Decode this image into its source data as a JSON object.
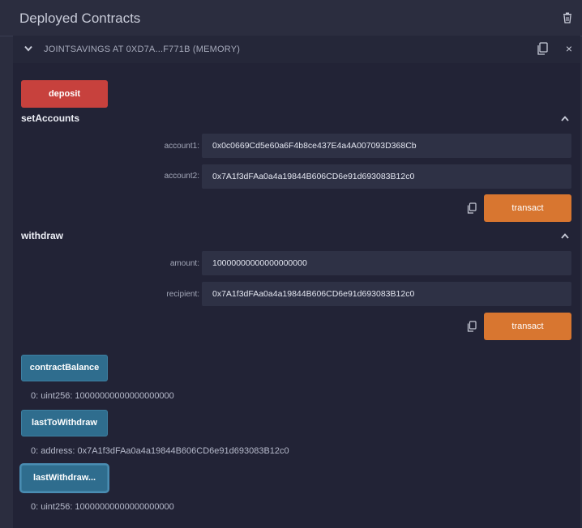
{
  "header": {
    "title": "Deployed Contracts"
  },
  "contract": {
    "title": "JOINTSAVINGS AT 0XD7A...F771B (MEMORY)",
    "close": "×"
  },
  "deposit": {
    "label": "deposit"
  },
  "setAccounts": {
    "label": "setAccounts",
    "fields": [
      {
        "label": "account1:",
        "value": "0x0c0669Cd5e60a6F4b8ce437E4a4A007093D368Cb"
      },
      {
        "label": "account2:",
        "value": "0x7A1f3dFAa0a4a19844B606CD6e91d693083B12c0"
      }
    ],
    "transact": "transact"
  },
  "withdraw": {
    "label": "withdraw",
    "fields": [
      {
        "label": "amount:",
        "value": "10000000000000000000"
      },
      {
        "label": "recipient:",
        "value": "0x7A1f3dFAa0a4a19844B606CD6e91d693083B12c0"
      }
    ],
    "transact": "transact"
  },
  "calls": [
    {
      "label": "contractBalance",
      "result": "0: uint256: 10000000000000000000"
    },
    {
      "label": "lastToWithdraw",
      "result": "0: address: 0x7A1f3dFAa0a4a19844B606CD6e91d693083B12c0"
    },
    {
      "label": "lastWithdraw...",
      "result": "0: uint256: 10000000000000000000"
    }
  ],
  "colors": {
    "deposit": "#c7413d",
    "transact": "#d87630",
    "call": "#2f6d8e"
  }
}
